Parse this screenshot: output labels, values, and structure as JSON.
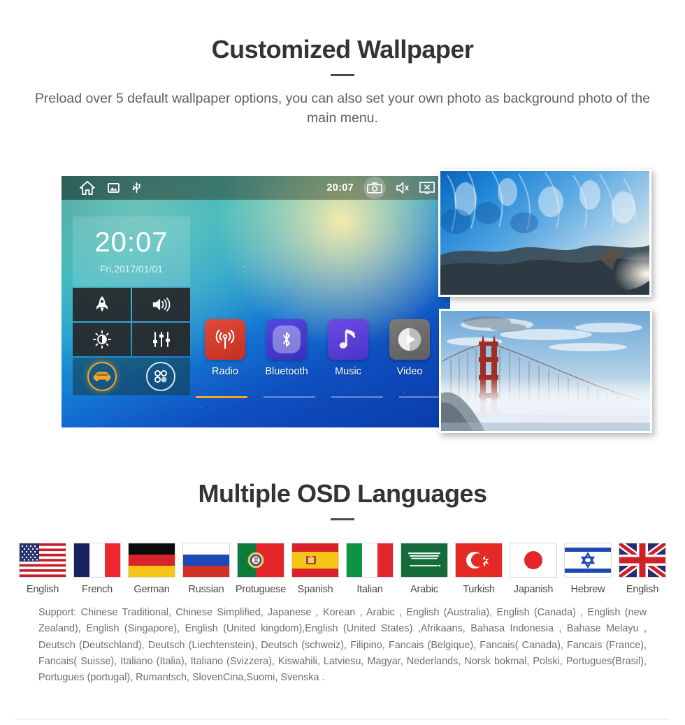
{
  "wallpaper_section": {
    "title": "Customized Wallpaper",
    "subtitle": "Preload over 5 default wallpaper options, you can also set your own photo as background photo of the main menu."
  },
  "head_unit": {
    "status_bar": {
      "home_icon": "home-icon",
      "gallery_icon": "gallery-icon",
      "usb_icon": "usb-icon",
      "time": "20:07",
      "screenshot_icon": "camera-icon",
      "mute_icon": "speaker-mute-icon",
      "screen_off_icon": "screen-off-icon"
    },
    "clock_widget": {
      "time": "20:07",
      "date": "Fri,2017/01/01"
    },
    "tiles": [
      {
        "name": "rocket-tile",
        "icon": "rocket-icon"
      },
      {
        "name": "volume-tile",
        "icon": "volume-icon"
      },
      {
        "name": "brightness-tile",
        "icon": "brightness-icon"
      },
      {
        "name": "equalizer-tile",
        "icon": "equalizer-icon"
      },
      {
        "name": "car-tile",
        "icon": "car-icon"
      },
      {
        "name": "apps-tile",
        "icon": "apps-grid-icon"
      }
    ],
    "apps": [
      {
        "label": "Radio",
        "icon": "radio-icon",
        "color": "#d8392b"
      },
      {
        "label": "Bluetooth",
        "icon": "bluetooth-icon",
        "color": "#4037c9"
      },
      {
        "label": "Music",
        "icon": "music-note-icon",
        "color": "#5b3fd6"
      },
      {
        "label": "Video",
        "icon": "play-icon",
        "color": "#6b6b6b"
      }
    ],
    "page_dots": {
      "count": 4,
      "active_index": 0,
      "active_color": "#f5a623"
    }
  },
  "photos": [
    {
      "name": "ice-cave-wallpaper",
      "subject": "blue ice cave"
    },
    {
      "name": "golden-gate-wallpaper",
      "subject": "golden gate bridge in fog"
    }
  ],
  "language_section": {
    "title": "Multiple OSD Languages",
    "flags": [
      {
        "label": "English",
        "country": "usa"
      },
      {
        "label": "French",
        "country": "france"
      },
      {
        "label": "German",
        "country": "germany"
      },
      {
        "label": "Russian",
        "country": "russia"
      },
      {
        "label": "Protuguese",
        "country": "portugal"
      },
      {
        "label": "Spanish",
        "country": "spain"
      },
      {
        "label": "Italian",
        "country": "italy"
      },
      {
        "label": "Arabic",
        "country": "saudi-arabia"
      },
      {
        "label": "Turkish",
        "country": "turkey"
      },
      {
        "label": "Japanish",
        "country": "japan"
      },
      {
        "label": "Hebrew",
        "country": "israel"
      },
      {
        "label": "English",
        "country": "united-kingdom"
      }
    ],
    "support_text": "Support: Chinese Traditional, Chinese Simplified, Japanese , Korean , Arabic , English (Australia), English (Canada) , English (new Zealand), English (Singapore), English (United kingdom),English (United States) ,Afrikaans, Bahasa Indonesia , Bahase Melayu , Deutsch (Deutschland), Deutsch (Liechtenstein), Deutsch (schweiz), Filipino, Fancais (Belgique), Fancais( Canada), Fancais (France), Fancais( Suisse), Italiano (Italia), Italiano (Svizzera), Kiswahili, Latviesu, Magyar, Nederlands, Norsk bokmal, Polski, Portugues(Brasil), Portugues (portugal), Rumantsch, SlovenCina,Suomi, Svenska ."
  }
}
